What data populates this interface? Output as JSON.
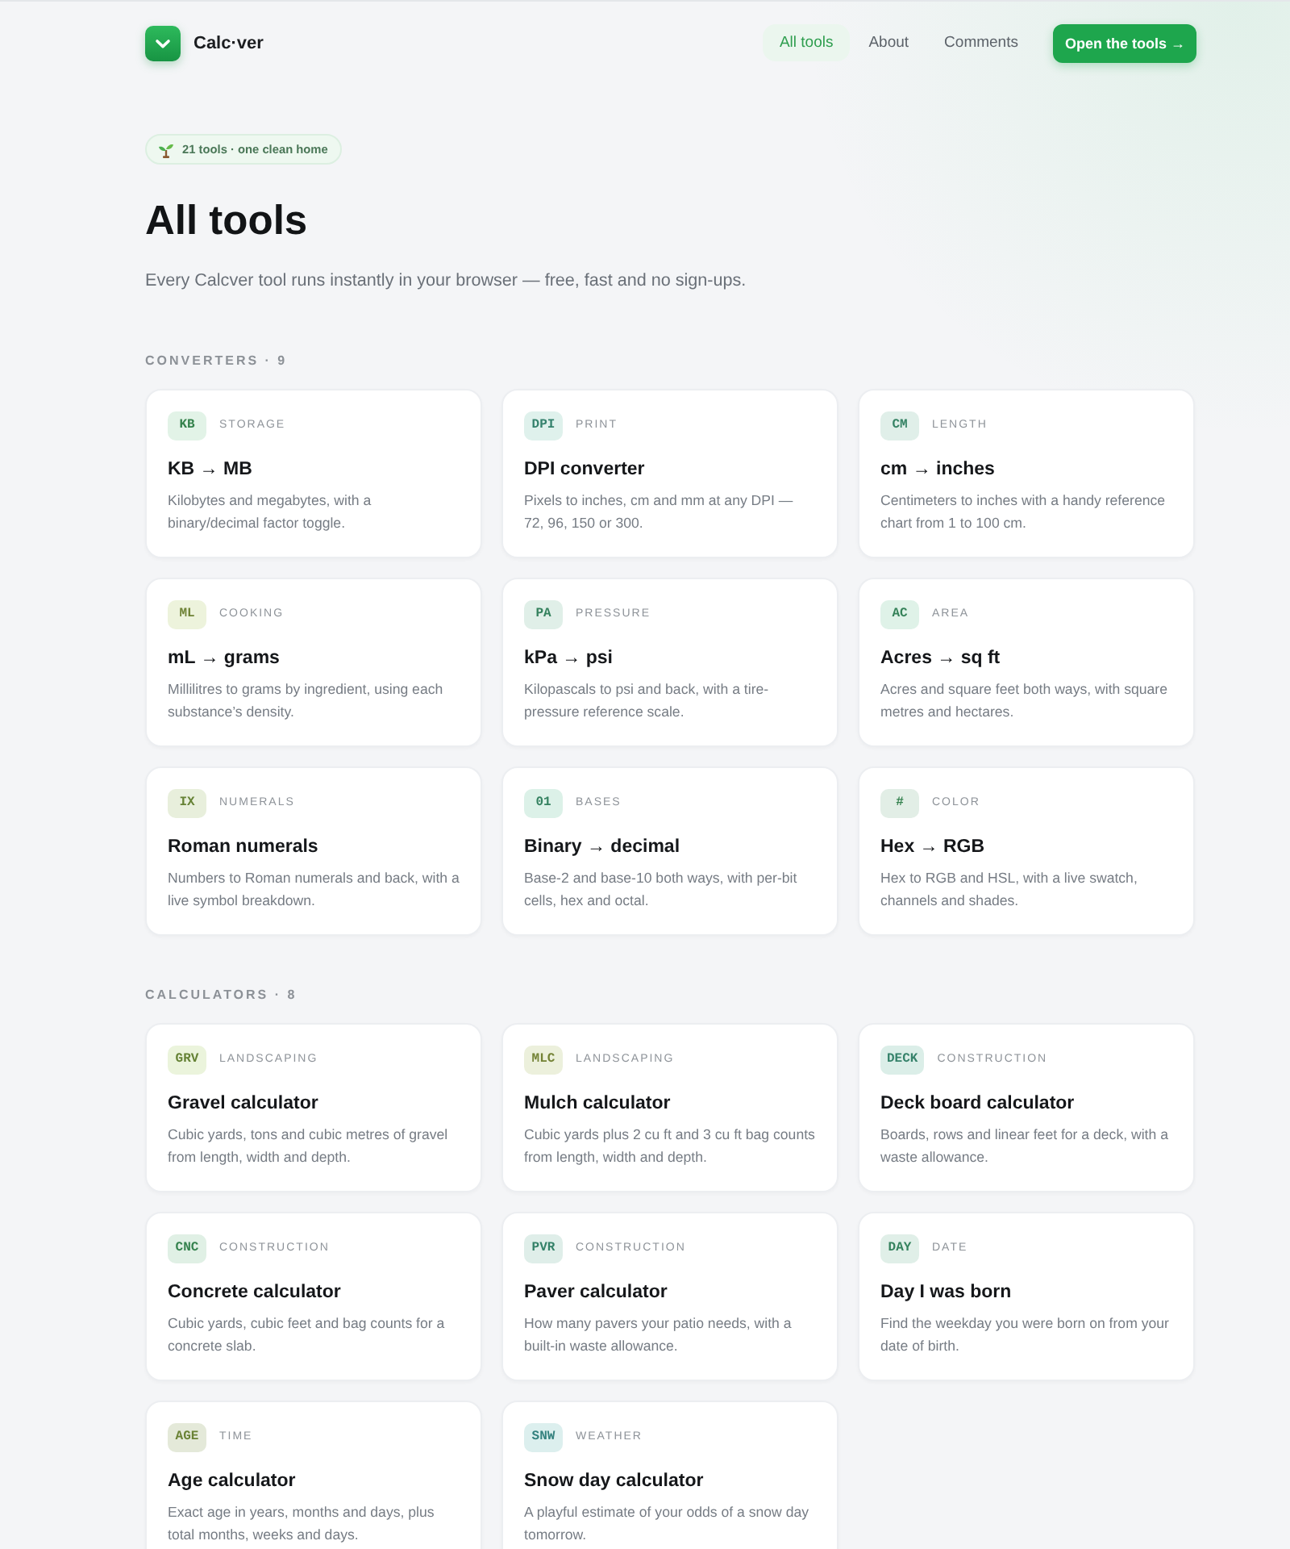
{
  "header": {
    "brand": "Calc·ver",
    "nav": [
      {
        "label": "All tools",
        "selected": true
      },
      {
        "label": "About",
        "selected": false
      },
      {
        "label": "Comments",
        "selected": false
      }
    ],
    "cta": "Open the tools →"
  },
  "hero": {
    "badge": "21 tools · one clean home",
    "title": "All tools",
    "subtitle": "Every Calcver tool runs instantly in your browser — free, fast and no sign-ups."
  },
  "sections": [
    {
      "heading": "CONVERTERS · 9",
      "tools": [
        {
          "tag": "KB",
          "color": "#e2f3e7",
          "category": "STORAGE",
          "title": "KB → MB",
          "description": "Kilobytes and megabytes, with a binary/decimal factor toggle."
        },
        {
          "tag": "DPI",
          "color": "#dff1ec",
          "category": "PRINT",
          "title": "DPI converter",
          "description": "Pixels to inches, cm and mm at any DPI — 72, 96, 150 or 300."
        },
        {
          "tag": "CM",
          "color": "#e0efe9",
          "category": "LENGTH",
          "title": "cm → inches",
          "description": "Centimeters to inches with a handy reference chart from 1 to 100 cm."
        },
        {
          "tag": "ML",
          "color": "#edf3dc",
          "category": "COOKING",
          "title": "mL → grams",
          "description": "Millilitres to grams by ingredient, using each substance’s density."
        },
        {
          "tag": "PA",
          "color": "#e0efe8",
          "category": "PRESSURE",
          "title": "kPa → psi",
          "description": "Kilopascals to psi and back, with a tire-pressure reference scale."
        },
        {
          "tag": "AC",
          "color": "#dff2e8",
          "category": "AREA",
          "title": "Acres → sq ft",
          "description": "Acres and square feet both ways, with square metres and hectares."
        },
        {
          "tag": "IX",
          "color": "#e8efdc",
          "category": "NUMERALS",
          "title": "Roman numerals",
          "description": "Numbers to Roman numerals and back, with a live symbol breakdown."
        },
        {
          "tag": "01",
          "color": "#dcf1e8",
          "category": "BASES",
          "title": "Binary → decimal",
          "description": "Base-2 and base-10 both ways, with per-bit cells, hex and octal."
        },
        {
          "tag": "#",
          "color": "#e2eee6",
          "category": "COLOR",
          "title": "Hex → RGB",
          "description": "Hex to RGB and HSL, with a live swatch, channels and shades."
        }
      ]
    },
    {
      "heading": "CALCULATORS · 8",
      "tools": [
        {
          "tag": "GRV",
          "color": "#ebf4dc",
          "category": "LANDSCAPING",
          "title": "Gravel calculator",
          "description": "Cubic yards, tons and cubic metres of gravel from length, width and depth."
        },
        {
          "tag": "MLC",
          "color": "#ecf0dc",
          "category": "LANDSCAPING",
          "title": "Mulch calculator",
          "description": "Cubic yards plus 2 cu ft and 3 cu ft bag counts from length, width and depth."
        },
        {
          "tag": "DECK",
          "color": "#dbeee8",
          "category": "CONSTRUCTION",
          "title": "Deck board calculator",
          "description": "Boards, rows and linear feet for a deck, with a waste allowance."
        },
        {
          "tag": "CNC",
          "color": "#e0f0e5",
          "category": "CONSTRUCTION",
          "title": "Concrete calculator",
          "description": "Cubic yards, cubic feet and bag counts for a concrete slab."
        },
        {
          "tag": "PVR",
          "color": "#dfeee9",
          "category": "CONSTRUCTION",
          "title": "Paver calculator",
          "description": "How many pavers your patio needs, with a built-in waste allowance."
        },
        {
          "tag": "DAY",
          "color": "#e0efe8",
          "category": "DATE",
          "title": "Day I was born",
          "description": "Find the weekday you were born on from your date of birth."
        },
        {
          "tag": "AGE",
          "color": "#e4e9d9",
          "category": "TIME",
          "title": "Age calculator",
          "description": "Exact age in years, months and days, plus total months, weeks and days."
        },
        {
          "tag": "SNW",
          "color": "#dcefee",
          "category": "WEATHER",
          "title": "Snow day calculator",
          "description": "A playful estimate of your odds of a snow day tomorrow."
        }
      ]
    }
  ]
}
